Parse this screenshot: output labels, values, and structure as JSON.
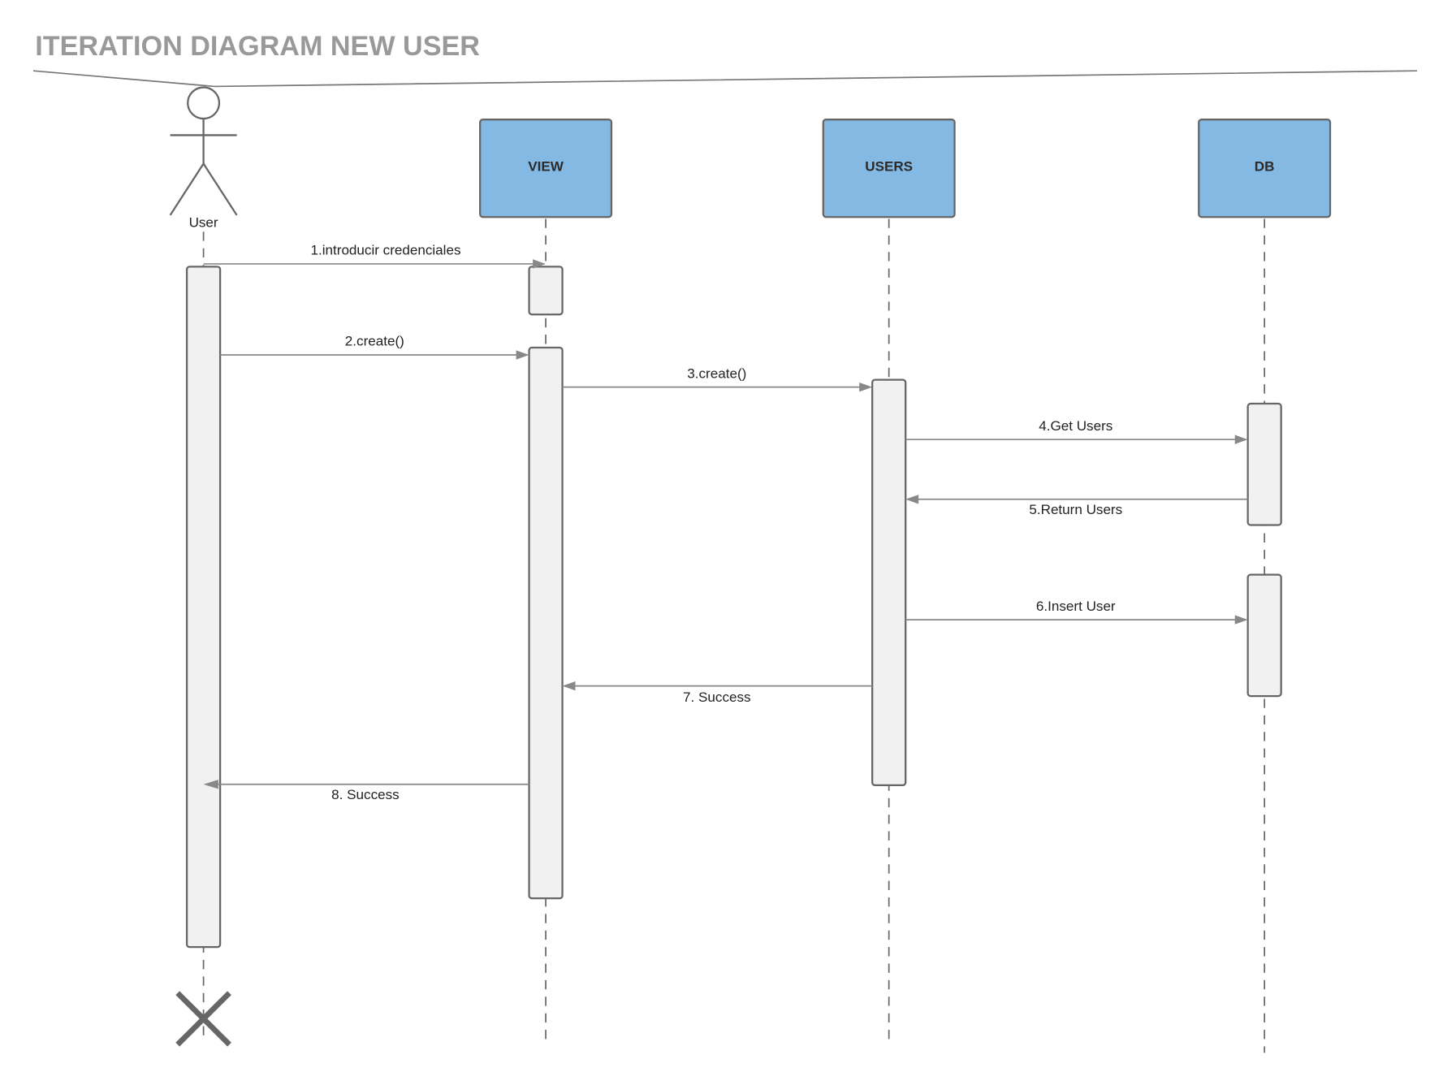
{
  "title": "ITERATION DIAGRAM NEW USER",
  "actor": {
    "label": "User"
  },
  "objects": [
    {
      "label": "VIEW"
    },
    {
      "label": "USERS"
    },
    {
      "label": "DB"
    }
  ],
  "colors": {
    "object_fill": "#84b9e3",
    "activation_fill": "#f1f1f1",
    "line": "#666666",
    "title": "#999999"
  },
  "messages": [
    {
      "label": "1.introducir credenciales",
      "from": "User",
      "to": "VIEW"
    },
    {
      "label": "2.create()",
      "from": "User",
      "to": "VIEW"
    },
    {
      "label": "3.create()",
      "from": "VIEW",
      "to": "USERS"
    },
    {
      "label": "4.Get Users",
      "from": "USERS",
      "to": "DB"
    },
    {
      "label": "5.Return Users",
      "from": "DB",
      "to": "USERS"
    },
    {
      "label": "6.Insert User",
      "from": "USERS",
      "to": "DB"
    },
    {
      "label": "7. Success",
      "from": "USERS",
      "to": "VIEW"
    },
    {
      "label": "8. Success",
      "from": "VIEW",
      "to": "User"
    }
  ]
}
